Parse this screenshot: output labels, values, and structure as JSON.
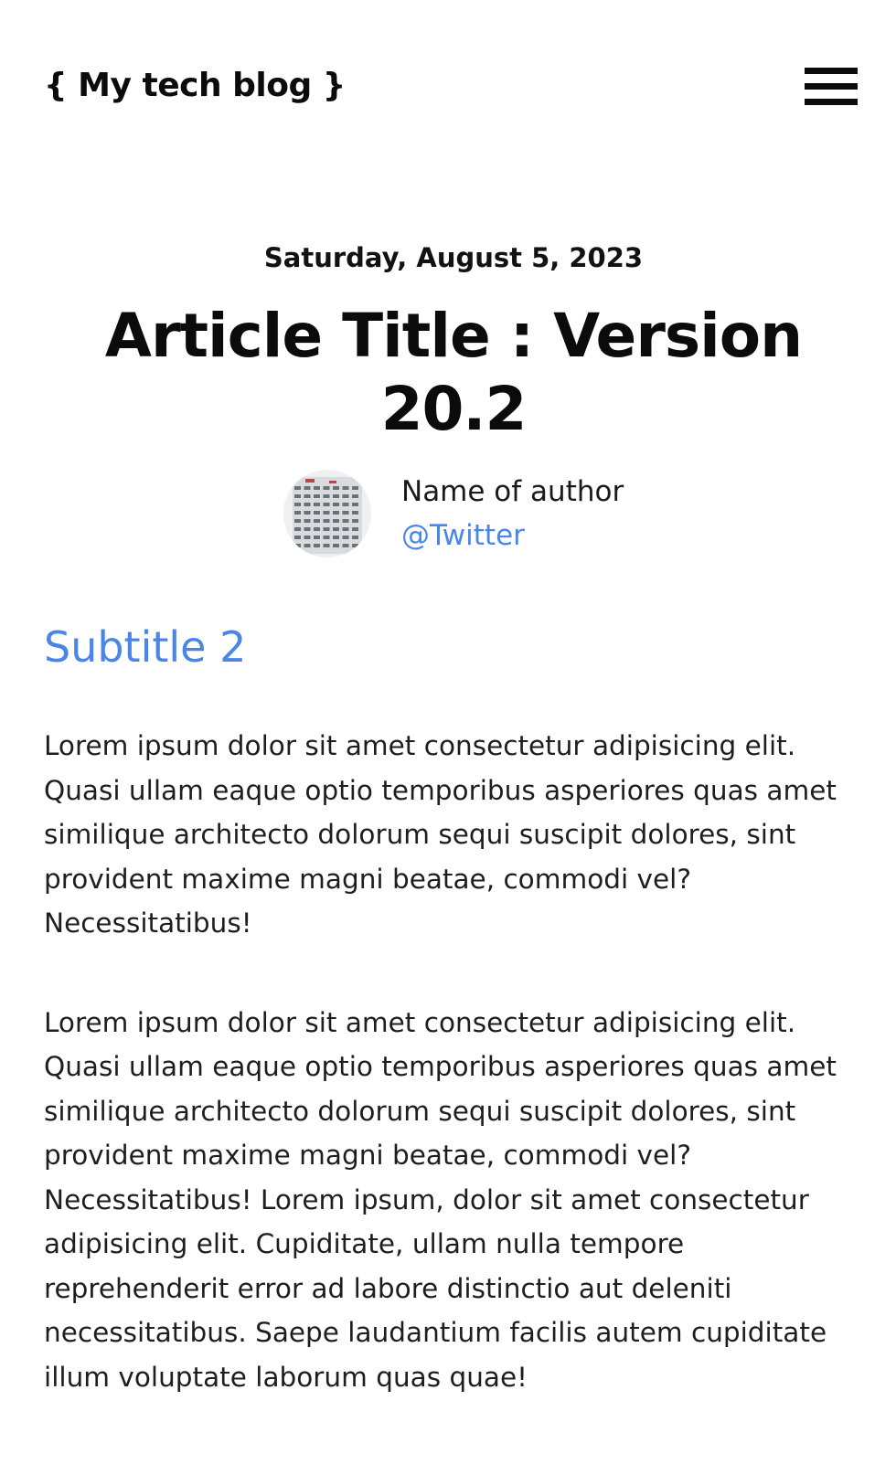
{
  "header": {
    "logo_text": "{ My tech blog }",
    "menu_icon": "hamburger-menu-icon"
  },
  "article": {
    "date": "Saturday, August 5, 2023",
    "title": "Article Title : Version 20.2",
    "author": {
      "name": "Name of author",
      "twitter": "@Twitter",
      "avatar": "building-facade-photo"
    },
    "subtitle": "Subtitle 2",
    "paragraphs": [
      "Lorem ipsum dolor sit amet consectetur adipisicing elit. Quasi ullam eaque optio temporibus asperiores quas amet similique architecto dolorum sequi suscipit dolores, sint provident maxime magni beatae, commodi vel? Necessitatibus!",
      "Lorem ipsum dolor sit amet consectetur adipisicing elit. Quasi ullam eaque optio temporibus asperiores quas amet similique architecto dolorum sequi suscipit dolores, sint provident maxime magni beatae, commodi vel? Necessitatibus! Lorem ipsum, dolor sit amet consectetur adipisicing elit. Cupiditate, ullam nulla tempore reprehenderit error ad labore distinctio aut deleniti necessitatibus. Saepe laudantium facilis autem cupiditate illum voluptate laborum quas quae!"
    ]
  },
  "colors": {
    "accent": "#4a86e8",
    "text": "#111111",
    "background": "#ffffff"
  }
}
